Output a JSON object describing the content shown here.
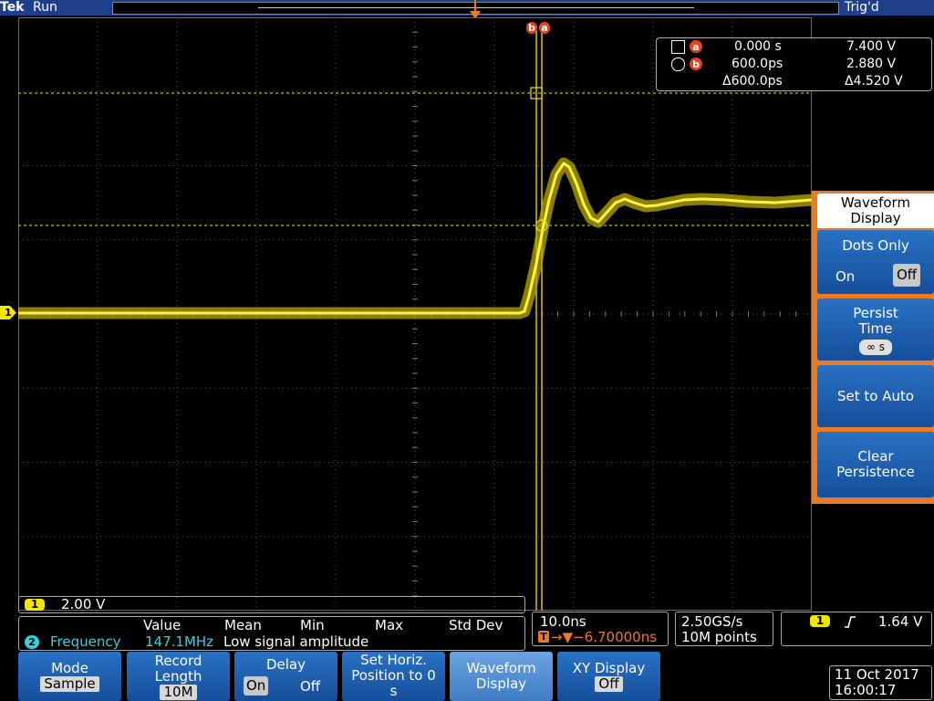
{
  "topbar": {
    "brand": "Tek",
    "run_status": "Run",
    "trig_status": "Trig'd"
  },
  "cursors": {
    "label_b": "b",
    "label_a": "a",
    "readout": {
      "a_time": "0.000 s",
      "a_volt": "7.400 V",
      "b_time": "600.0ps",
      "b_volt": "2.880 V",
      "delta_time": "Δ600.0ps",
      "delta_volt": "Δ4.520 V"
    }
  },
  "channel": {
    "marker": "1",
    "scale": "2.00 V"
  },
  "side_menu": {
    "title": "Waveform Display",
    "dots_only": {
      "label": "Dots Only",
      "on": "On",
      "off": "Off",
      "selected": "Off"
    },
    "persist_time": {
      "label": "Persist Time",
      "value": "∞ s"
    },
    "set_to_auto": "Set to Auto",
    "clear_persistence": "Clear Persistence"
  },
  "measurement": {
    "headers": [
      "Value",
      "Mean",
      "Min",
      "Max",
      "Std Dev"
    ],
    "channel": "2",
    "name": "Frequency",
    "value": "147.1MHz",
    "note": "Low signal amplitude"
  },
  "horizontal": {
    "scale": "10.0ns",
    "delay": "→▼−6.70000ns",
    "delay_badge": "T",
    "sample_rate": "2.50GS/s",
    "record_points": "10M points"
  },
  "trigger": {
    "channel": "1",
    "slope_icon": "rising-edge",
    "level": "1.64 V"
  },
  "bottom_menu": {
    "mode": {
      "label": "Mode",
      "value": "Sample"
    },
    "record_length": {
      "label": "Record Length",
      "value": "10M"
    },
    "delay": {
      "label": "Delay",
      "on": "On",
      "off": "Off",
      "selected": "On"
    },
    "set_horiz": {
      "label": "Set Horiz. Position to 0 s"
    },
    "waveform_display": {
      "label": "Waveform Display"
    },
    "xy_display": {
      "label": "XY Display",
      "value": "Off"
    }
  },
  "datetime": {
    "date": "11 Oct 2017",
    "time": "16:00:17"
  },
  "colors": {
    "trace": "#f5e600",
    "cursor": "#f5e600",
    "menu_blue": "#1d5fb4",
    "accent_orange": "#e87b2a",
    "badge_red": "#e8411f",
    "measure_cyan": "#35d0e0"
  }
}
